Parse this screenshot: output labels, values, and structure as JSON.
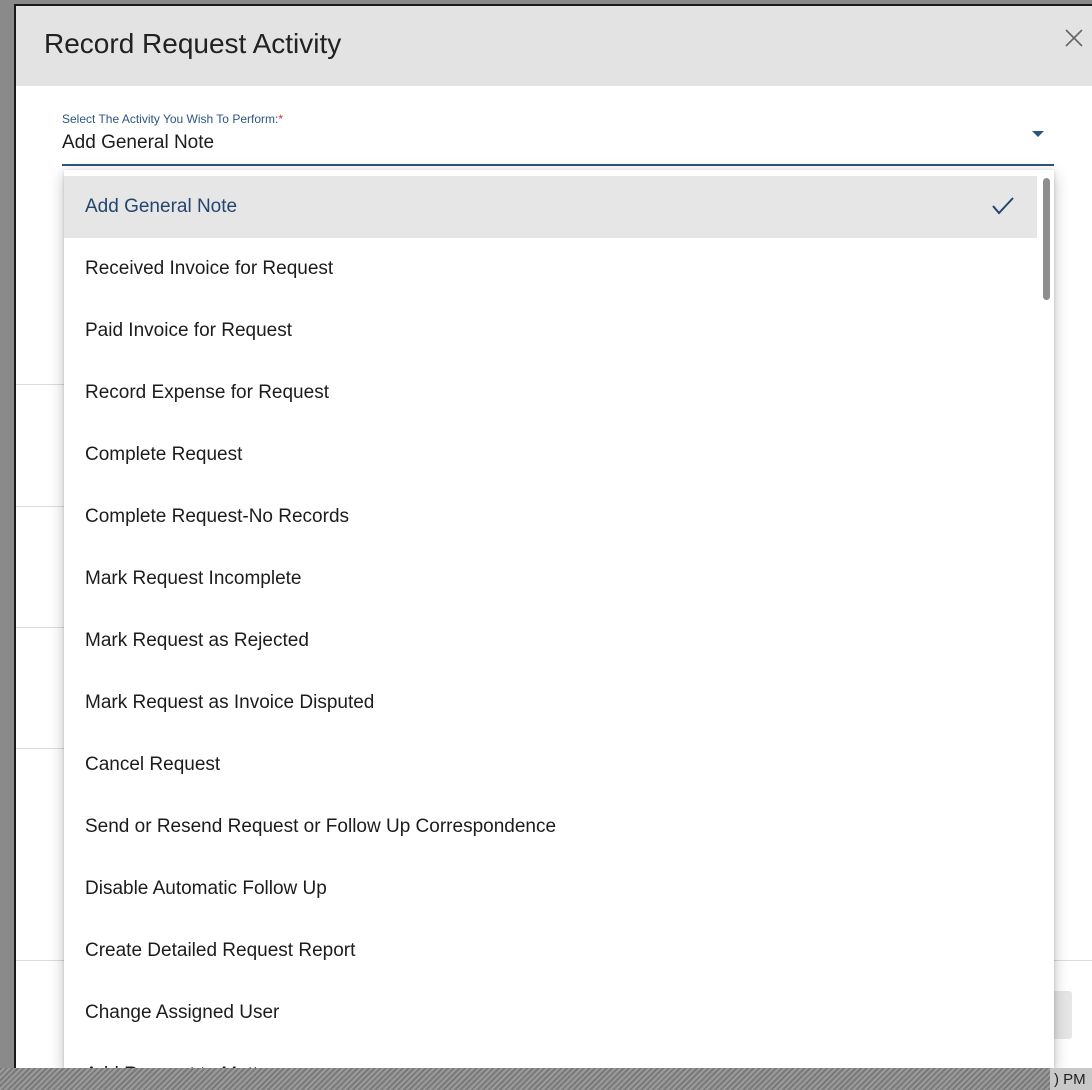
{
  "dialog": {
    "title": "Record Request Activity",
    "close_icon": "close-icon"
  },
  "select": {
    "label": "Select The Activity You Wish To Perform:",
    "required_mark": "*",
    "value": "Add General Note",
    "caret_icon": "caret-down-icon"
  },
  "menu": {
    "selected_index": 0,
    "check_icon": "check-icon",
    "items": [
      {
        "label": "Add General Note"
      },
      {
        "label": "Received Invoice for Request"
      },
      {
        "label": "Paid Invoice for Request"
      },
      {
        "label": "Record Expense for Request"
      },
      {
        "label": "Complete Request"
      },
      {
        "label": "Complete Request-No Records"
      },
      {
        "label": "Mark Request Incomplete"
      },
      {
        "label": "Mark Request as Rejected"
      },
      {
        "label": "Mark Request as Invoice Disputed"
      },
      {
        "label": "Cancel Request"
      },
      {
        "label": "Send or Resend Request or Follow Up Correspondence"
      },
      {
        "label": "Disable Automatic Follow Up"
      },
      {
        "label": "Create Detailed Request Report"
      },
      {
        "label": "Change Assigned User"
      },
      {
        "label": "Add Request to Matter"
      }
    ]
  },
  "background": {
    "time_fragment": ") PM"
  },
  "colors": {
    "accent": "#2d5580",
    "selected_text": "#23466e",
    "selected_bg": "#e6e6e6",
    "header_bg": "#e3e3e3",
    "required": "#d32f2f"
  }
}
